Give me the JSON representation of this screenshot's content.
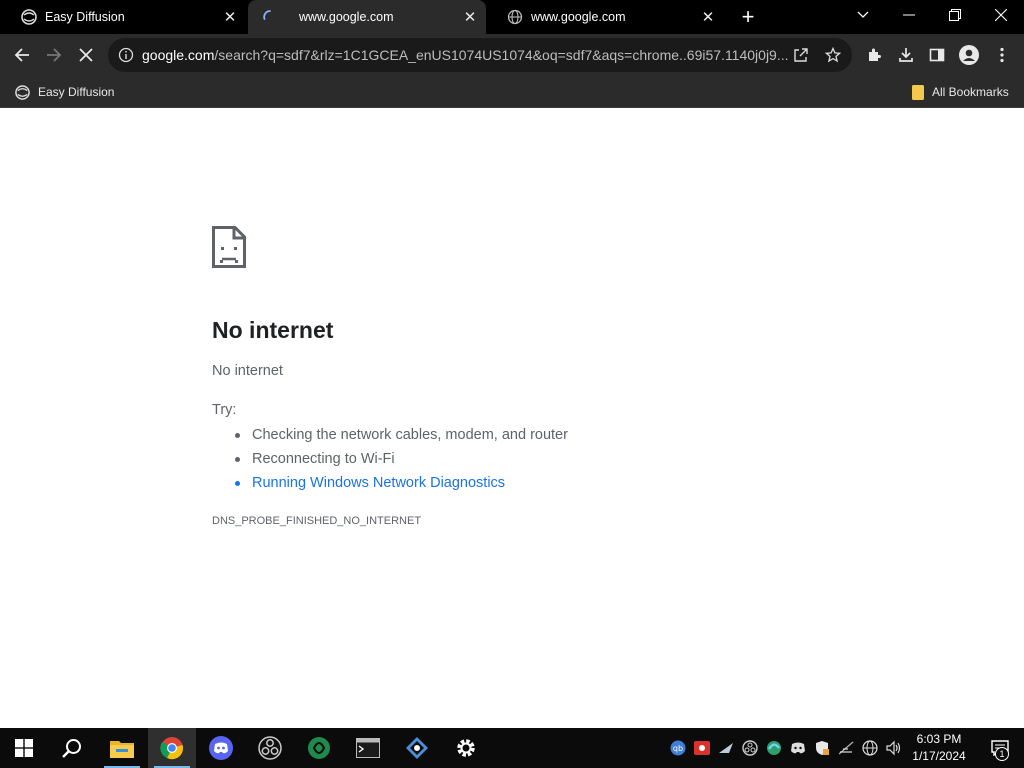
{
  "tabs": [
    {
      "title": "Easy Diffusion",
      "favicon": "easy-diffusion-icon",
      "active": false
    },
    {
      "title": "www.google.com",
      "favicon": "loading-spinner-icon",
      "active": true
    },
    {
      "title": "www.google.com",
      "favicon": "globe-icon",
      "active": false
    }
  ],
  "omnibox": {
    "host": "google.com",
    "path": "/search?q=sdf7&rlz=1C1GCEA_enUS1074US1074&oq=sdf7&aqs=chrome..69i57.1140j0j9..."
  },
  "bookmarks": {
    "items": [
      {
        "label": "Easy Diffusion",
        "icon": "easy-diffusion-icon"
      }
    ],
    "all_label": "All Bookmarks"
  },
  "error": {
    "title": "No internet",
    "subtitle": "No internet",
    "try_label": "Try:",
    "suggestions": [
      "Checking the network cables, modem, and router",
      "Reconnecting to Wi-Fi"
    ],
    "link": "Running Windows Network Diagnostics",
    "code": "DNS_PROBE_FINISHED_NO_INTERNET"
  },
  "taskbar": {
    "apps": [
      "start-icon",
      "search-icon",
      "file-explorer-icon",
      "chrome-icon",
      "discord-icon",
      "obs-icon",
      "app-green-icon",
      "terminal-icon",
      "network-app-icon",
      "settings-icon"
    ],
    "time": "6:03 PM",
    "date": "1/17/2024",
    "notification_count": "1"
  },
  "colors": {
    "tab_strip": "#000000",
    "toolbar": "#2b2b2b",
    "link": "#1a73e8",
    "taskbar": "#0b0b0b",
    "running_indicator": "#76b9ed"
  }
}
